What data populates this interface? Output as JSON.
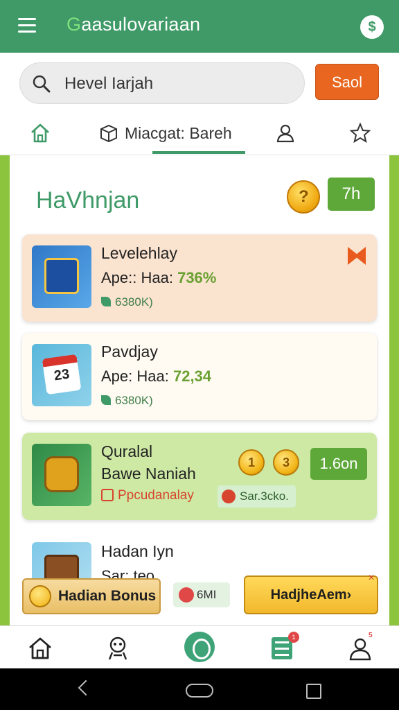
{
  "appbar": {
    "title_first": "G",
    "title_rest": "aasulovariaan",
    "menu_icon": "menu-icon",
    "help_icon": "help-icon",
    "help_glyph": "$"
  },
  "search": {
    "value": "Hevel Iarjah",
    "button_label": "Saol"
  },
  "tabs": {
    "main_label": "Miacgat: Bareh",
    "icons": [
      "home-icon",
      "cube-icon",
      "user-icon",
      "star-icon"
    ]
  },
  "section": {
    "title": "HaVhnjan",
    "pill": "7h"
  },
  "cards": [
    {
      "title": "Levelehlay",
      "sub_label": "Ape:: Haa:",
      "sub_value": "736%",
      "meta": "6380K)"
    },
    {
      "title": "Pavdjay",
      "sub_label": "Ape: Haa:",
      "sub_value": "72,34",
      "meta": "6380K)",
      "thumb_number": "23"
    },
    {
      "title_line1": "Quralal",
      "title_line2": "Bawe Naniah",
      "coin_a": "1",
      "coin_b": "3",
      "pill": "1.6on",
      "tag_red": "Ppcudanalay",
      "tag_green": "Sar.3cko."
    },
    {
      "title": "Hadan Iyn",
      "sub_label": "Sar: teo"
    }
  ],
  "banner": {
    "left_label": "Hadian Bonus",
    "mid_label": "6MI",
    "right_label": "HadjheAem›",
    "close": "×"
  },
  "bottomnav": {
    "items": [
      "home-icon",
      "game-mascot-icon",
      "profile-circle-icon",
      "list-icon",
      "person-icon"
    ],
    "list_badge": "1",
    "profile_badge": "5"
  },
  "colors": {
    "brand_green": "#3f9a68",
    "accent_orange": "#e8661f",
    "lime": "#8cc43e"
  }
}
